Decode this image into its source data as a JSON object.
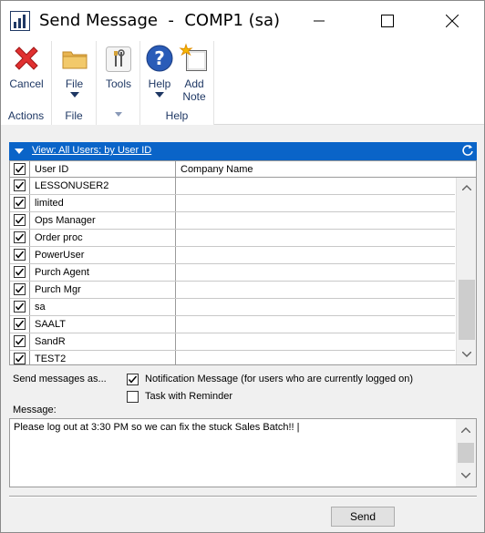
{
  "window": {
    "title": "Send Message  -  COMP1 (sa)"
  },
  "ribbon": {
    "groups": [
      {
        "label": "Actions",
        "buttons": [
          {
            "label": "Cancel",
            "icon": "cancel-x-icon"
          }
        ]
      },
      {
        "label": "File",
        "buttons": [
          {
            "label": "File",
            "icon": "folder-icon"
          }
        ]
      },
      {
        "label": "",
        "buttons": [
          {
            "label": "Tools",
            "icon": "tools-icon"
          }
        ]
      },
      {
        "label": "Help",
        "buttons": [
          {
            "label": "Help",
            "icon": "help-icon"
          },
          {
            "label": "Add",
            "label2": "Note",
            "icon": "add-note-icon"
          }
        ]
      }
    ]
  },
  "view": {
    "label": "View: All Users; by User ID"
  },
  "grid": {
    "columns": [
      "User ID",
      "Company Name"
    ],
    "header_checked": true,
    "rows": [
      {
        "user_id": "LESSONUSER2",
        "company": "",
        "checked": true
      },
      {
        "user_id": "limited",
        "company": "",
        "checked": true
      },
      {
        "user_id": "Ops Manager",
        "company": "",
        "checked": true
      },
      {
        "user_id": "Order proc",
        "company": "",
        "checked": true
      },
      {
        "user_id": "PowerUser",
        "company": "",
        "checked": true
      },
      {
        "user_id": "Purch Agent",
        "company": "",
        "checked": true
      },
      {
        "user_id": "Purch Mgr",
        "company": "",
        "checked": true
      },
      {
        "user_id": "sa",
        "company": "",
        "checked": true
      },
      {
        "user_id": "SAALT",
        "company": "",
        "checked": true
      },
      {
        "user_id": "SandR",
        "company": "",
        "checked": true
      },
      {
        "user_id": "TEST2",
        "company": "",
        "checked": true
      }
    ]
  },
  "options": {
    "send_as_label": "Send messages as...",
    "notification": {
      "label": "Notification Message (for users who are currently logged on)",
      "checked": true
    },
    "task": {
      "label": "Task with Reminder",
      "checked": false
    }
  },
  "message": {
    "label": "Message:",
    "value": "Please log out at 3:30 PM so we can fix the stuck Sales Batch!! |"
  },
  "actions": {
    "send_label": "Send"
  },
  "colors": {
    "view_bar": "#0a64c8",
    "ribbon_text": "#1f3864"
  }
}
